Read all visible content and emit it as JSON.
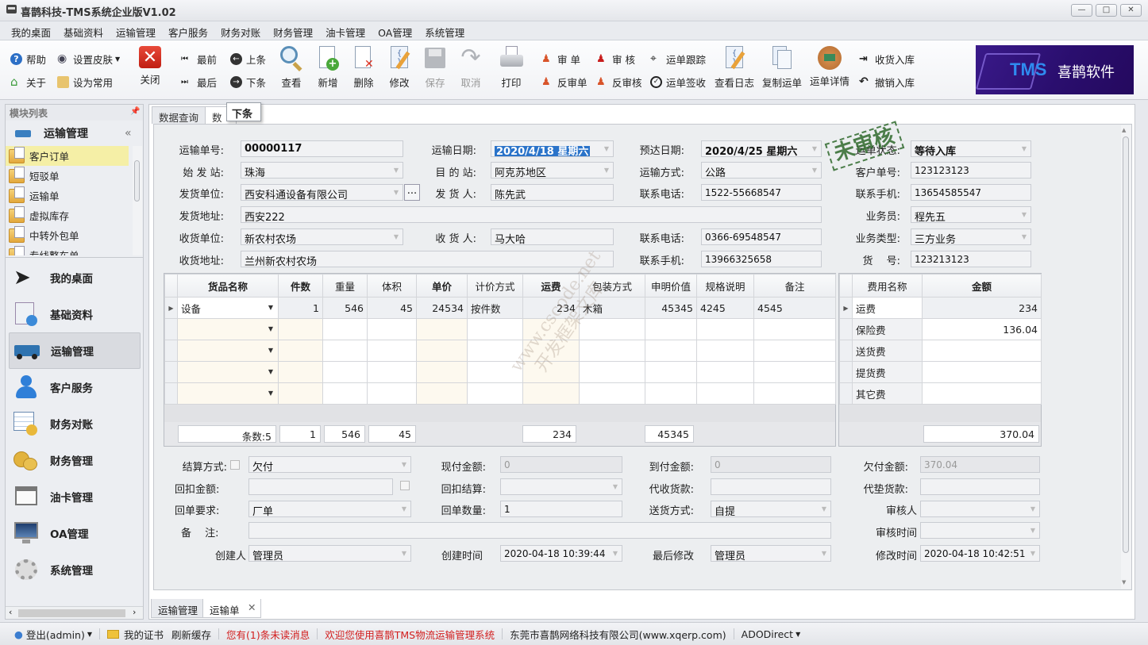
{
  "window": {
    "title": "喜鹊科技-TMS系统企业版V1.02",
    "controls": {
      "minimize": "—",
      "maximize": "□",
      "close": "✕"
    }
  },
  "menu": [
    "我的桌面",
    "基础资料",
    "运输管理",
    "客户服务",
    "财务对账",
    "财务管理",
    "油卡管理",
    "OA管理",
    "系统管理"
  ],
  "toolbar": {
    "help": "帮助",
    "about": "关于",
    "skin": "设置皮肤",
    "set_common": "设为常用",
    "close": "关闭",
    "first": "最前",
    "last": "最后",
    "prev": "上条",
    "next": "下条",
    "view": "查看",
    "add": "新增",
    "delete": "删除",
    "edit": "修改",
    "save": "保存",
    "cancel": "取消",
    "print": "打印",
    "audit_order": "审 单",
    "unaudit_order": "反审单",
    "audit": "审 核",
    "unaudit": "反审核",
    "track": "运单跟踪",
    "sign": "运单签收",
    "view_log": "查看日志",
    "copy_order": "复制运单",
    "order_detail": "运单详情",
    "receive_stock": "收货入库",
    "cancel_stock": "撤销入库"
  },
  "banner": {
    "tms": "TMS",
    "brand": "喜鹊软件"
  },
  "left_panel": {
    "header": "模块列表",
    "group_title": "运输管理",
    "sub_items": [
      "客户订单",
      "短驳单",
      "运输单",
      "虚拟库存",
      "中转外包单",
      "专线整车单"
    ],
    "active_sub": 0,
    "nav_items": [
      "我的桌面",
      "基础资料",
      "运输管理",
      "客户服务",
      "财务对账",
      "财务管理",
      "油卡管理",
      "OA管理",
      "系统管理"
    ],
    "active_nav": 2
  },
  "top_tabs": [
    "数据查询",
    "数据"
  ],
  "tooltip": "下条",
  "stamp": "未审核",
  "watermark": {
    "line1": "www.cscode.net",
    "line2": "开发框架文库"
  },
  "form": {
    "order_no": {
      "label": "运输单号:",
      "value": "00000117"
    },
    "ship_date": {
      "label": "运输日期:",
      "value": "2020/4/18 星期六"
    },
    "eta_date": {
      "label": "预达日期:",
      "value": "2020/4/25 星期六"
    },
    "status": {
      "label": "运单状态:",
      "value": "等待入库"
    },
    "origin": {
      "label": "始 发 站:",
      "value": "珠海"
    },
    "dest": {
      "label": "目 的 站:",
      "value": "阿克苏地区"
    },
    "transport_mode": {
      "label": "运输方式:",
      "value": "公路"
    },
    "customer_no": {
      "label": "客户单号:",
      "value": "123123123"
    },
    "shipper_company": {
      "label": "发货单位:",
      "value": "西安科通设备有限公司"
    },
    "shipper": {
      "label": "发 货 人:",
      "value": "陈先武"
    },
    "shipper_phone": {
      "label": "联系电话:",
      "value": "1522-55668547"
    },
    "shipper_mobile": {
      "label": "联系手机:",
      "value": "13654585547"
    },
    "shipper_addr": {
      "label": "发货地址:",
      "value": "西安222"
    },
    "salesman": {
      "label": "业务员:",
      "value": "程先五"
    },
    "consignee_company": {
      "label": "收货单位:",
      "value": "新农村农场"
    },
    "consignee": {
      "label": "收 货 人:",
      "value": "马大哈"
    },
    "consignee_phone": {
      "label": "联系电话:",
      "value": "0366-69548547"
    },
    "biz_type": {
      "label": "业务类型:",
      "value": "三方业务"
    },
    "consignee_addr": {
      "label": "收货地址:",
      "value": "兰州新农村农场"
    },
    "consignee_mobile": {
      "label": "联系手机:",
      "value": "13966325658"
    },
    "cargo_no": {
      "label": "货　 号:",
      "value": "123213123"
    },
    "ellipsis": "..."
  },
  "goods_grid": {
    "columns": [
      "货品名称",
      "件数",
      "重量",
      "体积",
      "单价",
      "计价方式",
      "运费",
      "包装方式",
      "申明价值",
      "规格说明",
      "备注"
    ],
    "rows": [
      [
        "设备",
        "1",
        "546",
        "45",
        "24534",
        "按件数",
        "234",
        "木箱",
        "45345",
        "4245",
        "4545"
      ],
      [
        "",
        "",
        "",
        "",
        "",
        "",
        "",
        "",
        "",
        "",
        ""
      ],
      [
        "",
        "",
        "",
        "",
        "",
        "",
        "",
        "",
        "",
        "",
        ""
      ],
      [
        "",
        "",
        "",
        "",
        "",
        "",
        "",
        "",
        "",
        "",
        ""
      ],
      [
        "",
        "",
        "",
        "",
        "",
        "",
        "",
        "",
        "",
        "",
        ""
      ]
    ],
    "totals": {
      "count": "条数:5",
      "pieces": "1",
      "weight": "546",
      "volume": "45",
      "freight": "234",
      "declared": "45345"
    }
  },
  "fee_grid": {
    "columns": [
      "费用名称",
      "金额"
    ],
    "rows": [
      [
        "运费",
        "234"
      ],
      [
        "保险费",
        "136.04"
      ],
      [
        "送货费",
        ""
      ],
      [
        "提货费",
        ""
      ],
      [
        "其它费",
        ""
      ]
    ],
    "total": "370.04"
  },
  "settlement": {
    "settle_mode": {
      "label": "结算方式:",
      "value": "欠付"
    },
    "cash_amount": {
      "label": "现付金额:",
      "value": "0"
    },
    "cod_amount": {
      "label": "到付金额:",
      "value": "0"
    },
    "owed_amount": {
      "label": "欠付金额:",
      "value": "370.04"
    },
    "rebate_amount": {
      "label": "回扣金额:",
      "value": ""
    },
    "rebate_settle": {
      "label": "回扣结算:",
      "value": ""
    },
    "collect_payment": {
      "label": "代收货款:",
      "value": ""
    },
    "advance_payment": {
      "label": "代垫货款:",
      "value": ""
    },
    "receipt_req": {
      "label": "回单要求:",
      "value": "厂单"
    },
    "receipt_qty": {
      "label": "回单数量:",
      "value": "1"
    },
    "delivery_mode": {
      "label": "送货方式:",
      "value": "自提"
    },
    "auditor": {
      "label": "审核人",
      "value": ""
    },
    "remark": {
      "label": "备　 注:",
      "value": ""
    },
    "audit_time": {
      "label": "审核时间",
      "value": ""
    },
    "creator": {
      "label": "创建人",
      "value": "管理员"
    },
    "create_time": {
      "label": "创建时间",
      "value": "2020-04-18 10:39:44"
    },
    "last_modifier": {
      "label": "最后修改",
      "value": "管理员"
    },
    "modify_time": {
      "label": "修改时间",
      "value": "2020-04-18 10:42:51"
    }
  },
  "bottom_tabs": [
    "运输管理",
    "运输单"
  ],
  "statusbar": {
    "logout": "登出(admin)",
    "cert": "我的证书",
    "refresh": "刷新缓存",
    "unread": "您有(1)条未读消息",
    "welcome": "欢迎您使用喜鹊TMS物流运输管理系统",
    "company": "东莞市喜鹊网络科技有限公司(www.xqerp.com)",
    "db": "ADODirect"
  },
  "colors": {
    "accent": "#2a73c9",
    "alert_red": "#d21e1e",
    "stamp_green": "#2f6a2c",
    "highlight_yellow": "#f5efa6"
  }
}
